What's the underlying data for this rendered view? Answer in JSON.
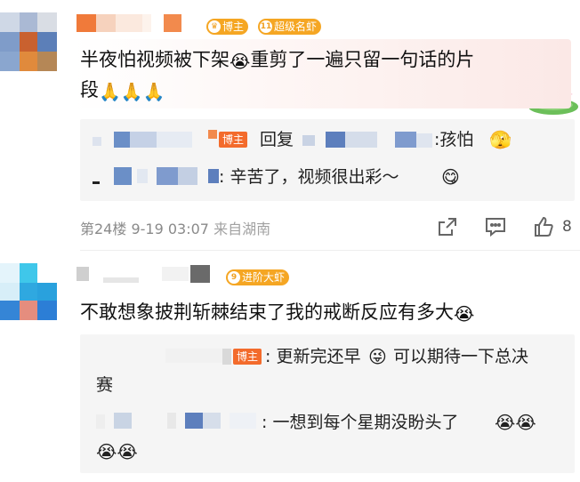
{
  "comment1": {
    "badge_host": "博主",
    "badge_level_num": "11",
    "badge_level": "超级名虾",
    "text_line1": "半夜怕视频被下架",
    "text_line1b": "重剪了一遍只留一句话的片",
    "text_line2": "段",
    "emoji_cry": "😭",
    "emoji_pray": "🙏🙏🙏",
    "replies": [
      {
        "tag": "博主",
        "prefix": "回复",
        "suffix": ":孩怕",
        "emoji": "🫣"
      },
      {
        "text": ": 辛苦了，视频很出彩～",
        "emoji": "😋"
      }
    ],
    "floor": "第24楼",
    "date": "9-19 03:07",
    "location": "来自湖南",
    "share_icon": "share-icon",
    "comment_icon": "comment-icon",
    "like_icon": "like-icon",
    "likes": "8"
  },
  "comment2": {
    "badge_level_num": "9",
    "badge_level": "进阶大虾",
    "text": "不敢想象披荆斩棘结束了我的戒断反应有多大",
    "emoji_cry": "😭",
    "replies": [
      {
        "tag": "博主",
        "text_line1": ": 更新完还早",
        "emoji_wink": "😜",
        "text_line1b": "可以期待一下总决",
        "text_line2": "赛"
      },
      {
        "text": ": 一想到每个星期没盼头了",
        "emoji": "😭😭",
        "emoji_line2": "😭😭"
      }
    ]
  },
  "colors": {
    "host_tag": "#f36b2c",
    "badge_gold": "#f5a623",
    "meta_gray": "#8a8a8a",
    "reply_bg": "#f5f5f5"
  }
}
